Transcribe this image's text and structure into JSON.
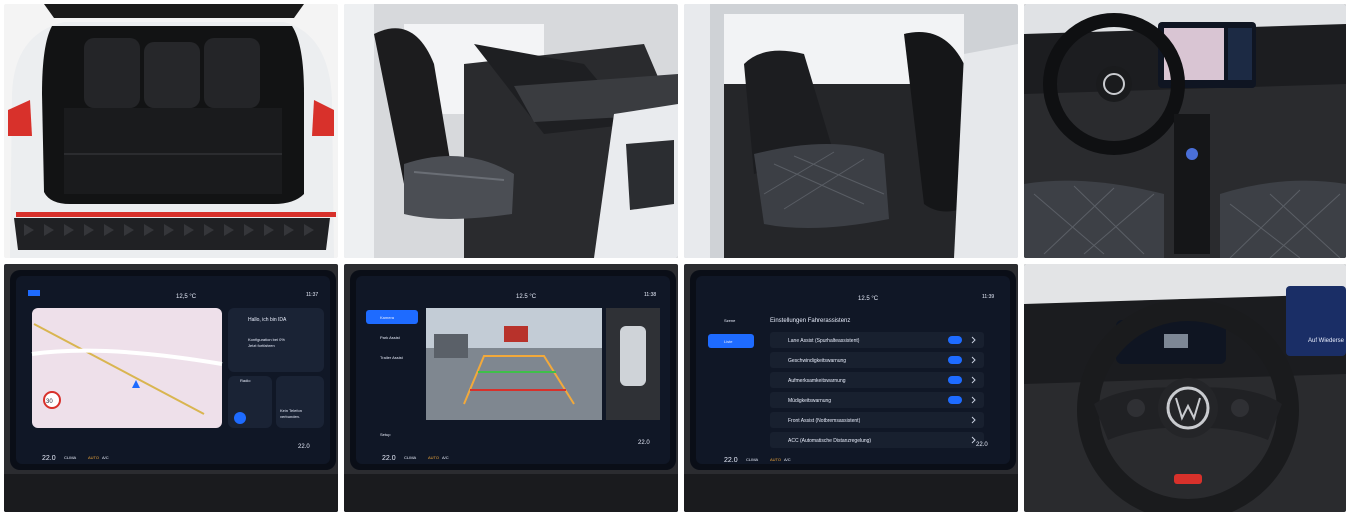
{
  "colors": {
    "car_white": "#eef0f2",
    "interior_black": "#1b1c1f",
    "taillight_red": "#d8312b",
    "screen_blue": "#1e6bff",
    "screen_bg": "#101726",
    "map_pink": "#eee0ea"
  },
  "photos": [
    {
      "subject": "rear cargo area"
    },
    {
      "subject": "front seats"
    },
    {
      "subject": "rear seats"
    },
    {
      "subject": "dashboard and cockpit"
    },
    {
      "subject": "infotainment navigation"
    },
    {
      "subject": "infotainment rear camera"
    },
    {
      "subject": "infotainment driver assistance"
    },
    {
      "subject": "steering wheel"
    }
  ],
  "nav_screen": {
    "temperature": "12,5 °C",
    "clock": "11:37",
    "greeting": "Hallo, ich bin IDA",
    "config_line1": "Konfiguration bei 0%",
    "config_line2": "Jetzt fortfahren",
    "radio": "Radio",
    "phone_line1": "Kein Telefon",
    "phone_line2": "verbunden.",
    "speed_limit": "30",
    "climate_temp_left": "22.0",
    "climate_label": "CLIMA",
    "auto_label": "AUTO",
    "ac_label": "A/C",
    "climate_temp_right": "22.0"
  },
  "camera_screen": {
    "temperature": "12.5 °C",
    "clock": "11:38",
    "menu": [
      "Kamera",
      "Park Assist",
      "Trailer Assist"
    ],
    "setup": "Setup",
    "climate_temp_left": "22.0",
    "climate_label": "CLIMA",
    "auto_label": "AUTO",
    "ac_label": "A/C",
    "climate_temp_right": "22.0"
  },
  "assist_screen": {
    "temperature": "12.5 °C",
    "clock": "11:39",
    "side_items": [
      "Szene",
      "Liste"
    ],
    "title": "Einstellungen Fahrerassistenz",
    "items": [
      "Lane Assist (Spurhalteassistent)",
      "Geschwindigkeitswarnung",
      "Aufmerksamkeitswarnung",
      "Müdigkeitswarnung",
      "Front Assist (Notbremsassistent)",
      "ACC (Automatische Distanzregelung)"
    ],
    "toggles": [
      true,
      true,
      true,
      true,
      false,
      false
    ],
    "climate_temp_left": "22.0",
    "climate_label": "CLIMA",
    "auto_label": "AUTO",
    "ac_label": "A/C",
    "climate_temp_right": "22.0"
  },
  "wheel_screen": {
    "greeting": "Auf Wiederse"
  }
}
